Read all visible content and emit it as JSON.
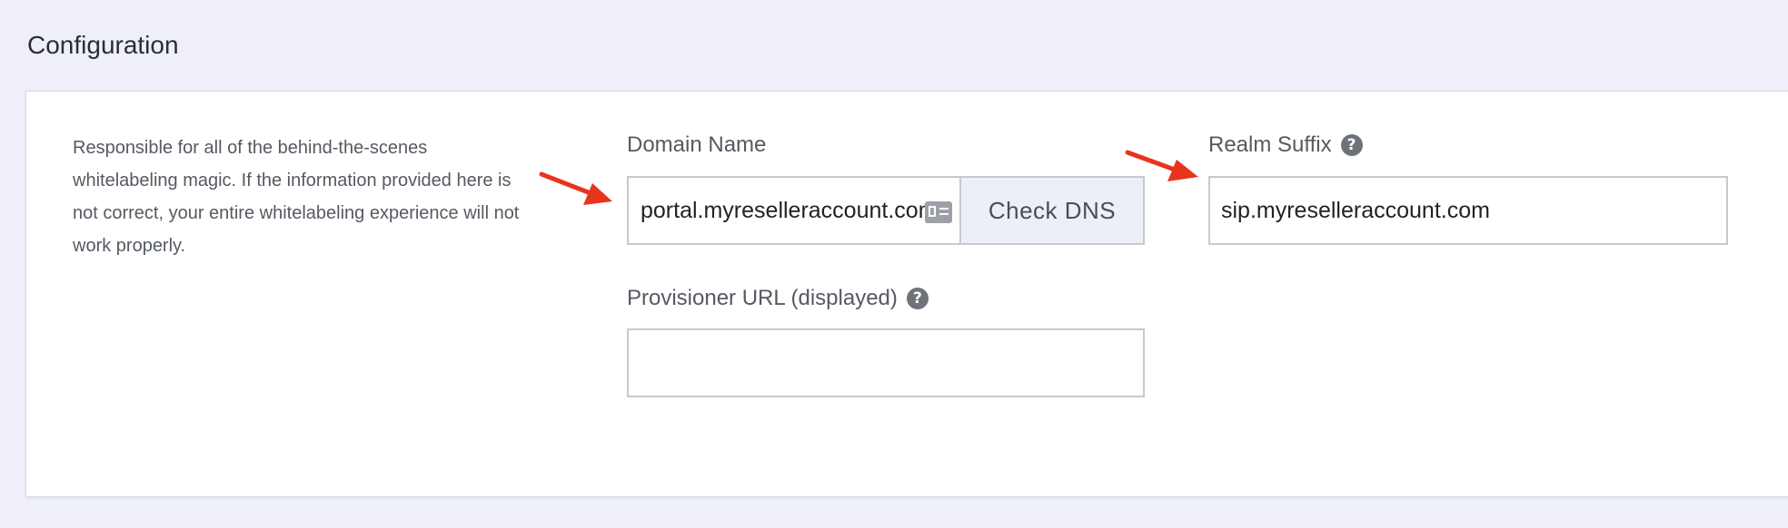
{
  "section": {
    "title": "Configuration"
  },
  "description": "Responsible for all of the behind-the-scenes whitelabeling magic. If the information provided here is not correct, your entire whitelabeling experience will not work properly.",
  "fields": {
    "domain_name": {
      "label": "Domain Name",
      "value": "portal.myreselleraccount.com",
      "button_label": "Check DNS"
    },
    "realm_suffix": {
      "label": "Realm Suffix",
      "value": "sip.myreselleraccount.com",
      "help_icon": "question-circle-icon"
    },
    "provisioner_url": {
      "label": "Provisioner URL (displayed)",
      "value": "",
      "help_icon": "question-circle-icon"
    }
  },
  "annotations": {
    "arrow_color": "#e8341c"
  },
  "colors": {
    "page_background": "#eeeff8",
    "panel_background": "#ffffff",
    "button_background": "#eceef8"
  }
}
